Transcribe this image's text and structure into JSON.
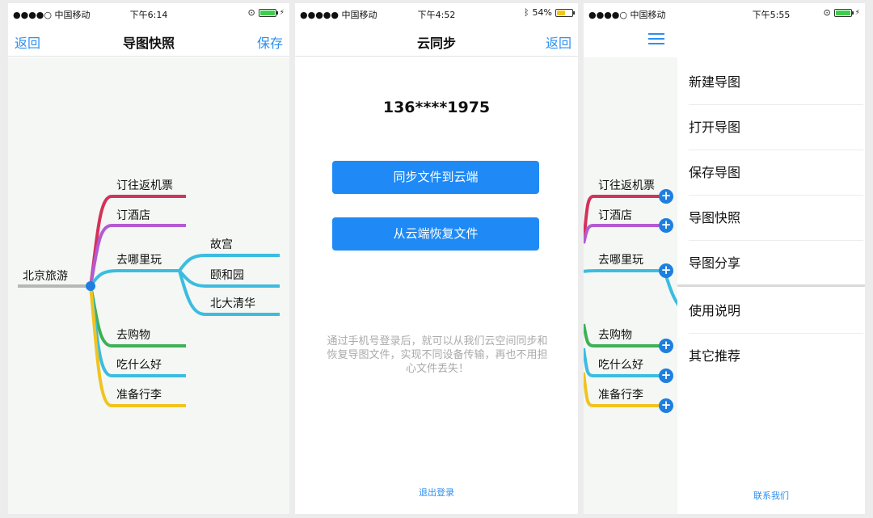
{
  "colors": {
    "accent": "#2d8ff0",
    "button": "#1f8af5",
    "battery_green": "#3ecf4a",
    "battery_yellow": "#f5c518",
    "branch_red": "#d3325a",
    "branch_purple": "#b45ad2",
    "branch_cyan": "#3cbce0",
    "branch_green": "#3db155",
    "branch_yellow": "#f0c420",
    "root_gray": "#b7b7b7"
  },
  "screen1": {
    "status": {
      "carrier": "●●●●○ 中国移动",
      "time": "下午6:14",
      "wifi_icon": "wifi-icon",
      "lock_icon": "rotation-lock-icon"
    },
    "nav": {
      "back": "返回",
      "title": "导图快照",
      "save": "保存"
    },
    "mindmap": {
      "root": "北京旅游",
      "branches": [
        "订往返机票",
        "订酒店",
        "去哪里玩",
        "去购物",
        "吃什么好",
        "准备行李"
      ],
      "sub": [
        "故宫",
        "颐和园",
        "北大清华"
      ]
    }
  },
  "screen2": {
    "status": {
      "carrier": "●●●●● 中国移动",
      "time": "下午4:52",
      "battery": "54%",
      "bluetooth_icon": "bluetooth-icon"
    },
    "nav": {
      "title": "云同步",
      "back": "返回"
    },
    "phone": "136****1975",
    "btn_sync": "同步文件到云端",
    "btn_restore": "从云端恢复文件",
    "description": "通过手机号登录后，就可以从我们云空间同步和恢复导图文件，实现不同设备传输，再也不用担心文件丢失！",
    "logout": "退出登录"
  },
  "screen3": {
    "status": {
      "carrier": "●●●●○ 中国移动",
      "time": "下午5:55"
    },
    "menu": [
      "新建导图",
      "打开导图",
      "保存导图",
      "导图快照",
      "导图分享"
    ],
    "menu2": [
      "使用说明",
      "其它推荐"
    ],
    "contact": "联系我们",
    "branches": [
      "订往返机票",
      "订酒店",
      "去哪里玩",
      "去购物",
      "吃什么好",
      "准备行李"
    ]
  }
}
